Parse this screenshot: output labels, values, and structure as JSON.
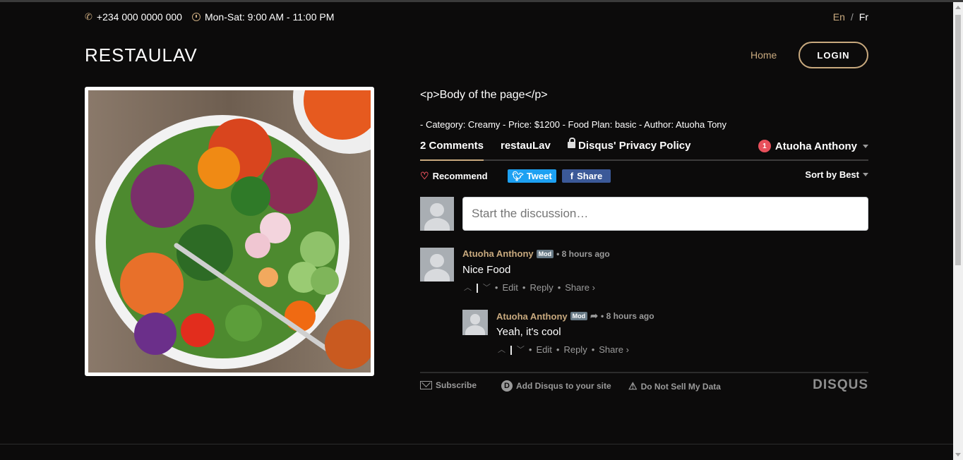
{
  "topbar": {
    "phone": "+234 000 0000 000",
    "hours": "Mon-Sat: 9:00 AM - 11:00 PM",
    "lang_en": "En",
    "lang_sep": "/",
    "lang_fr": "Fr"
  },
  "header": {
    "logo": "RESTAULAV",
    "nav_home": "Home",
    "login": "LOGIN"
  },
  "content": {
    "body_text": "<p>Body of the page</p>",
    "meta": "- Category: Creamy - Price: $1200 - Food Plan: basic - Author: Atuoha Tony"
  },
  "disqus": {
    "tab_comments": "2 Comments",
    "tab_site": "restauLav",
    "tab_privacy": "Disqus' Privacy Policy",
    "notif_count": "1",
    "user_name": "Atuoha Anthony",
    "recommend": "Recommend",
    "tweet": "Tweet",
    "share": "Share",
    "sort": "Sort by Best",
    "placeholder": "Start the discussion…",
    "comments": [
      {
        "author": "Atuoha Anthony",
        "badge": "Mod",
        "time": "• 8 hours ago",
        "text": "Nice Food",
        "edit": "Edit",
        "reply": "Reply",
        "share": "Share ›"
      },
      {
        "author": "Atuoha Anthony",
        "badge": "Mod",
        "time": "• 8 hours ago",
        "text": "Yeah, it's cool",
        "edit": "Edit",
        "reply": "Reply",
        "share": "Share ›"
      }
    ],
    "footer": {
      "subscribe": "Subscribe",
      "add": "Add Disqus to your site",
      "dnsmd": "Do Not Sell My Data",
      "logo": "DISQUS"
    }
  },
  "colors": {
    "accent": "#c8a97e",
    "background": "#0c0b0b",
    "tweet": "#1da1f2",
    "facebook": "#3b5998",
    "notification": "#e8505b"
  }
}
